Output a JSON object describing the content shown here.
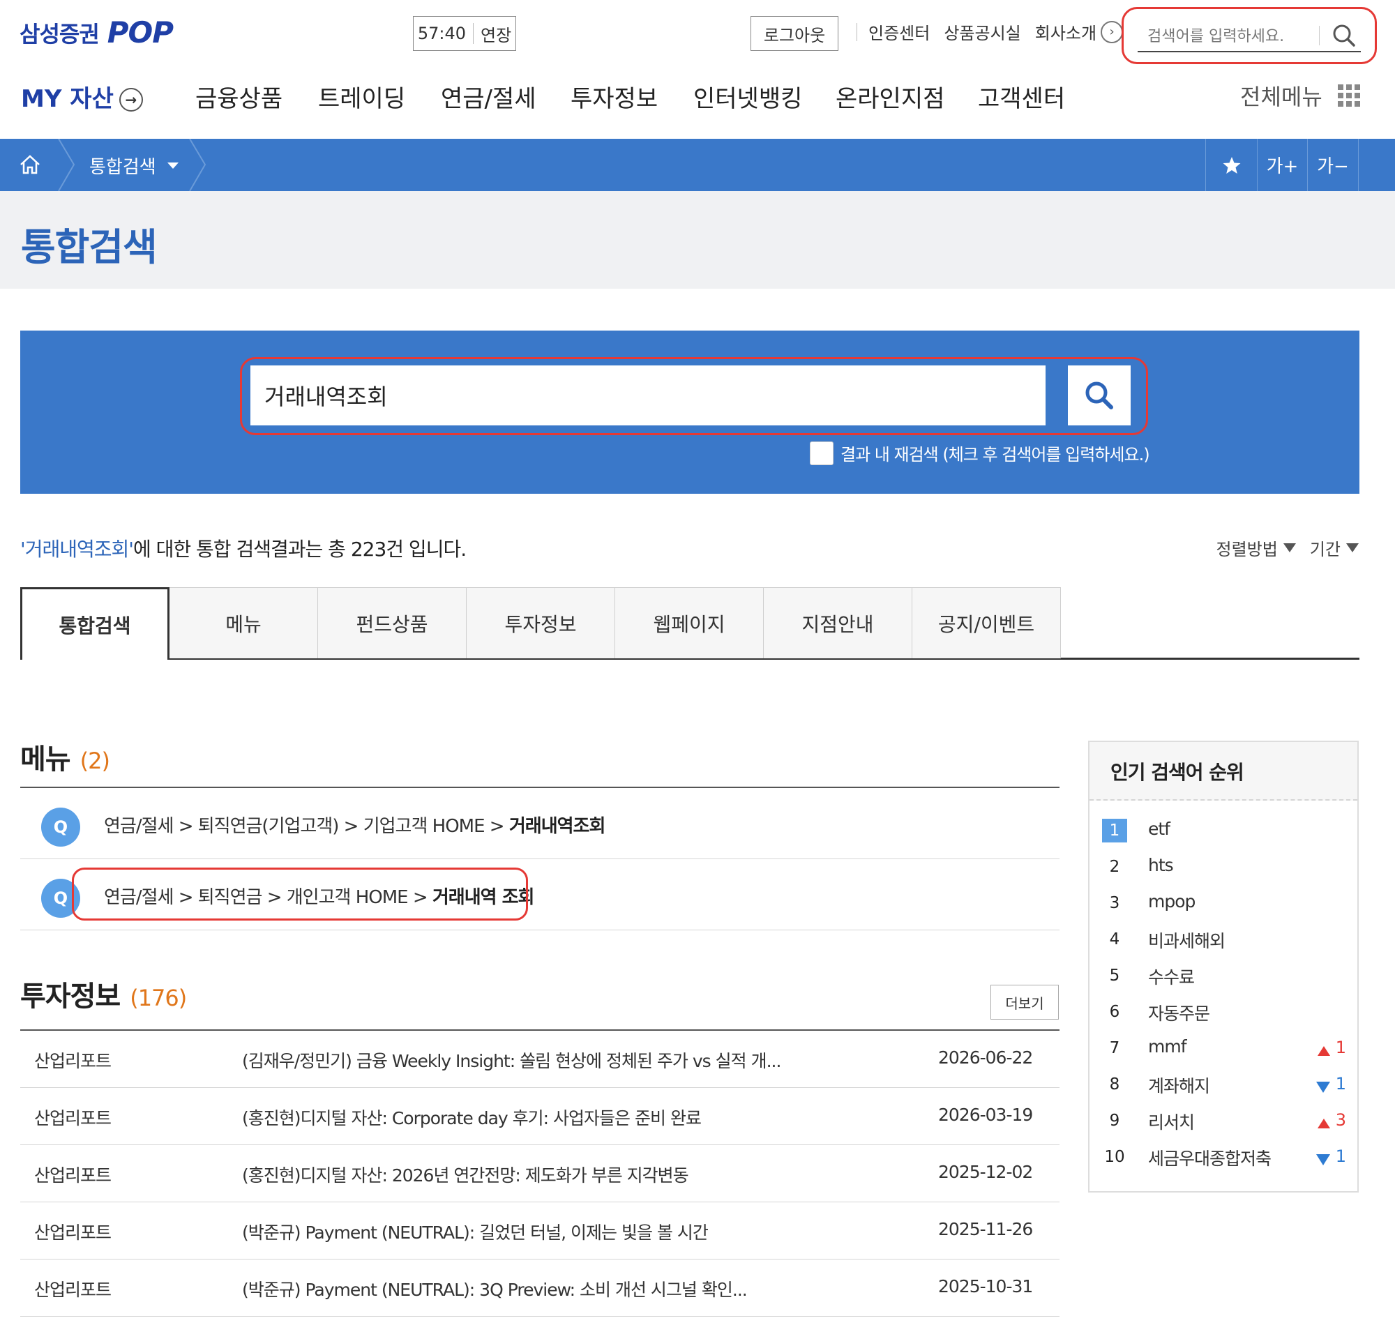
{
  "header": {
    "logo_ko": "삼성증권",
    "logo_pop": "POP",
    "timer": "57:40",
    "extend_label": "연장",
    "logout_label": "로그아웃",
    "links": [
      "인증센터",
      "상품공시실",
      "회사소개"
    ],
    "search_placeholder": "검색어를 입력하세요."
  },
  "gnb": {
    "my_asset": "MY 자산",
    "items": [
      "금융상품",
      "트레이딩",
      "연금/절세",
      "투자정보",
      "인터넷뱅킹",
      "온라인지점",
      "고객센터"
    ],
    "all_menu": "전체메뉴"
  },
  "breadcrumb": {
    "current": "통합검색",
    "font_plus": "가+",
    "font_minus": "가−"
  },
  "page_title": "통합검색",
  "search": {
    "query": "거래내역조회",
    "research_label": "결과 내 재검색 (체크 후 검색어를 입력하세요.)"
  },
  "summary": {
    "keyword": "'거래내역조회'",
    "text": "에 대한 통합 검색결과는 총 223건 입니다.",
    "sort_label": "정렬방법",
    "period_label": "기간"
  },
  "tabs": [
    "통합검색",
    "메뉴",
    "펀드상품",
    "투자정보",
    "웹페이지",
    "지점안내",
    "공지/이벤트"
  ],
  "menu_section": {
    "title": "메뉴",
    "count": "(2)",
    "badge": "Q",
    "rows": [
      {
        "path": "연금/절세 > 퇴직연금(기업고객) > 기업고객 HOME > ",
        "target": "거래내역조회"
      },
      {
        "path": "연금/절세 > 퇴직연금 > 개인고객 HOME > ",
        "target": "거래내역 조회"
      }
    ]
  },
  "invest_section": {
    "title": "투자정보",
    "count": "(176)",
    "more_label": "더보기",
    "rows": [
      {
        "category": "산업리포트",
        "title": "(김재우/정민기) 금융 Weekly Insight: 쏠림 현상에 정체된 주가 vs 실적 개...",
        "date": "2026-06-22"
      },
      {
        "category": "산업리포트",
        "title": "(홍진현)디지털 자산: Corporate day 후기: 사업자들은 준비 완료",
        "date": "2026-03-19"
      },
      {
        "category": "산업리포트",
        "title": "(홍진현)디지털 자산: 2026년 연간전망: 제도화가 부른 지각변동",
        "date": "2025-12-02"
      },
      {
        "category": "산업리포트",
        "title": "(박준규) Payment (NEUTRAL): 길었던 터널, 이제는 빛을 볼 시간",
        "date": "2025-11-26"
      },
      {
        "category": "산업리포트",
        "title": "(박준규) Payment (NEUTRAL): 3Q Preview: 소비 개선 시그널 확인...",
        "date": "2025-10-31"
      }
    ]
  },
  "popular": {
    "title": "인기 검색어 순위",
    "items": [
      {
        "rank": "1",
        "term": "etf",
        "change": "",
        "dir": ""
      },
      {
        "rank": "2",
        "term": "hts",
        "change": "",
        "dir": ""
      },
      {
        "rank": "3",
        "term": "mpop",
        "change": "",
        "dir": ""
      },
      {
        "rank": "4",
        "term": "비과세해외",
        "change": "",
        "dir": ""
      },
      {
        "rank": "5",
        "term": "수수료",
        "change": "",
        "dir": ""
      },
      {
        "rank": "6",
        "term": "자동주문",
        "change": "",
        "dir": ""
      },
      {
        "rank": "7",
        "term": "mmf",
        "change": "1",
        "dir": "up"
      },
      {
        "rank": "8",
        "term": "계좌해지",
        "change": "1",
        "dir": "down"
      },
      {
        "rank": "9",
        "term": "리서치",
        "change": "3",
        "dir": "up"
      },
      {
        "rank": "10",
        "term": "세금우대종합저축",
        "change": "1",
        "dir": "down"
      }
    ]
  },
  "colors": {
    "brand_blue": "#1f3fa6",
    "bar_blue": "#3a78c9",
    "highlight_red": "#e53935",
    "count_orange": "#e0761a"
  }
}
